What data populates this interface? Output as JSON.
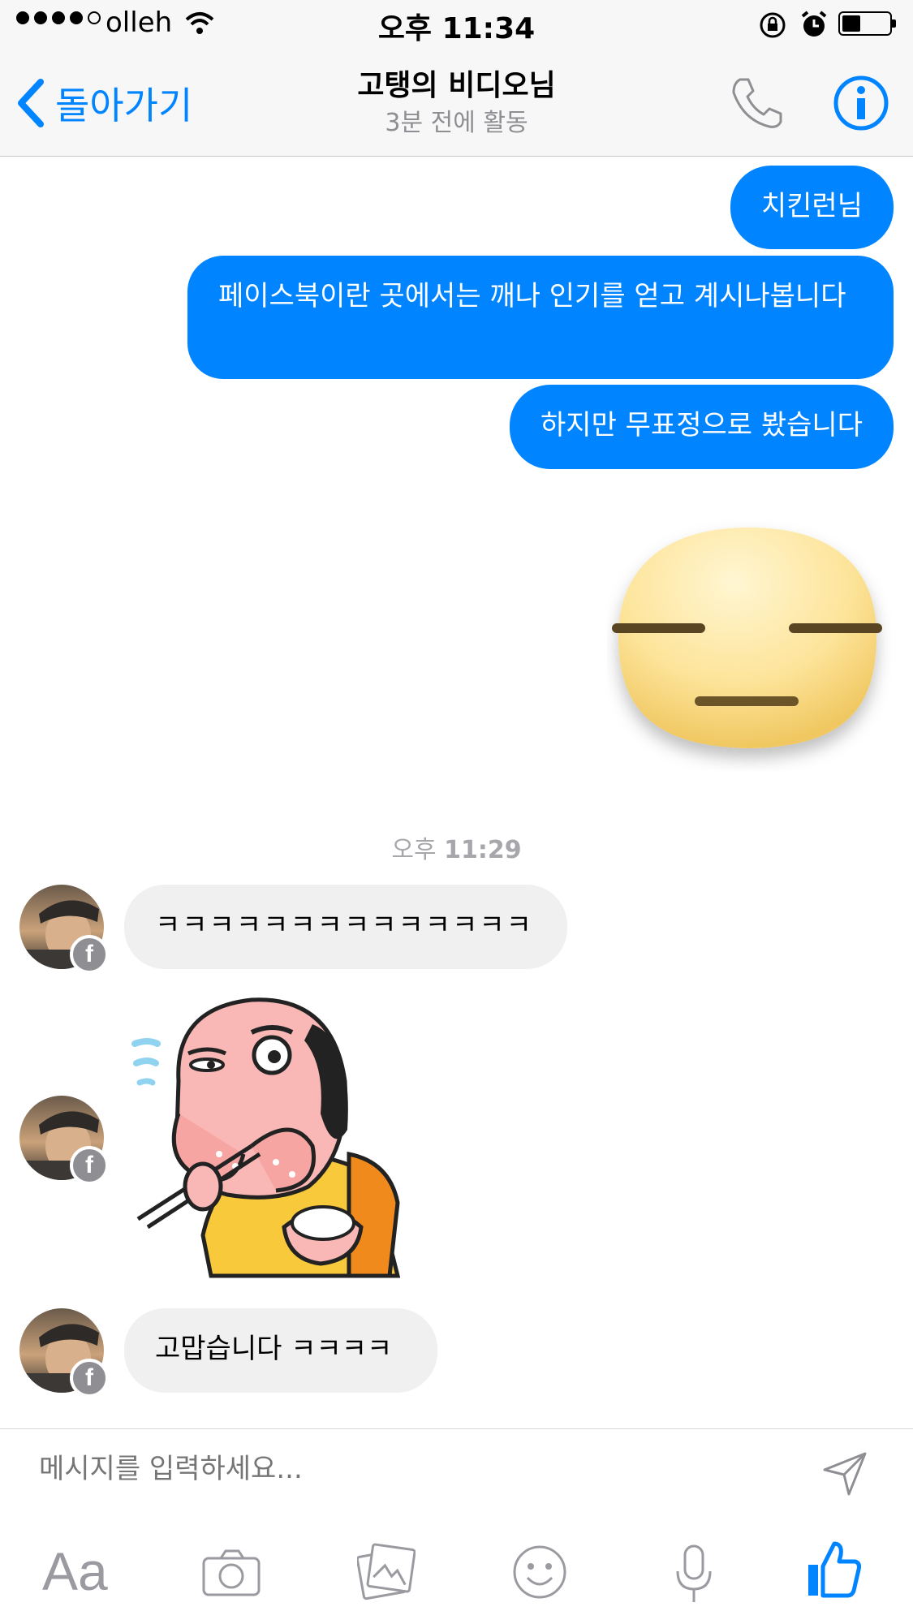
{
  "status_bar": {
    "carrier": "olleh",
    "time": "오후 11:34"
  },
  "nav": {
    "back_label": "돌아가기",
    "title": "고탱의 비디오님",
    "subtitle": "3분 전에 활동"
  },
  "messages": {
    "outgoing": [
      "치킨런님",
      "페이스북이란 곳에서는 깨나 인기를 얻고 계시나봅니다",
      "하지만 무표정으로 봤습니다"
    ],
    "timestamp_prefix": "오후",
    "timestamp_time": "11:29",
    "incoming": [
      "ㅋㅋㅋㅋㅋㅋㅋㅋㅋㅋㅋㅋㅋㅋ",
      "고맙습니다 ㅋㅋㅋㅋ"
    ]
  },
  "composer": {
    "placeholder": "메시지를 입력하세요..."
  },
  "toolbar": {
    "text_button": "Aa"
  },
  "colors": {
    "accent": "#0084ff",
    "incoming_bubble": "#f1f0f0",
    "nav_bg": "#f7f7f7"
  },
  "icons": [
    "back-chevron-icon",
    "phone-icon",
    "info-icon",
    "facebook-badge-icon",
    "send-icon",
    "camera-icon",
    "gallery-icon",
    "emoji-icon",
    "microphone-icon",
    "like-icon"
  ]
}
